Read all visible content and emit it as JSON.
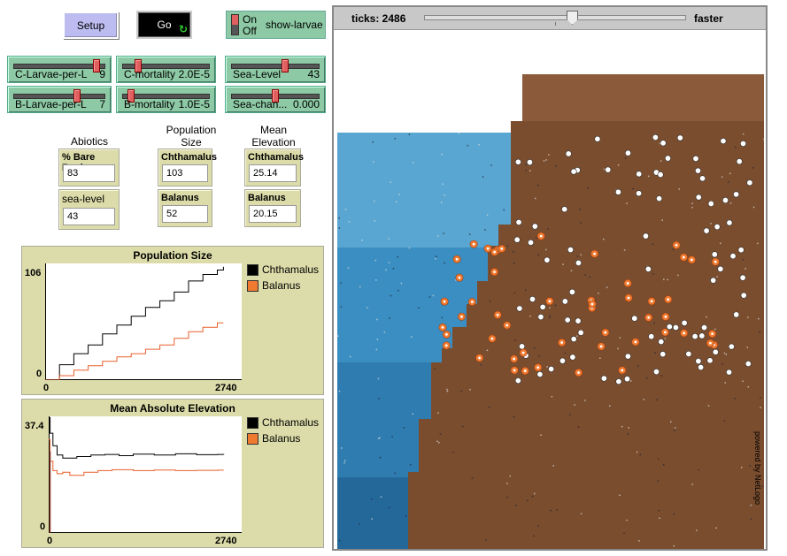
{
  "buttons": {
    "setup": "Setup",
    "go": "Go"
  },
  "switch": {
    "on": "On",
    "off": "Off",
    "label": "show-larvae"
  },
  "sliders": [
    {
      "label": "C-Larvae-per-L",
      "value": "9",
      "frac": 0.9
    },
    {
      "label": "C-mortality",
      "value": "2.0E-5",
      "frac": 0.1
    },
    {
      "label": "Sea-Level",
      "value": "43",
      "frac": 0.55
    },
    {
      "label": "B-Larvae-per-L",
      "value": "7",
      "frac": 0.7
    },
    {
      "label": "B-mortality",
      "value": "1.0E-5",
      "frac": 0.05
    },
    {
      "label": "Sea-chan...",
      "value": "0.000",
      "frac": 0.5
    }
  ],
  "headers": {
    "abiotics": "Abiotics",
    "population": "Population Size",
    "elevation": "Mean Elevation"
  },
  "monitors": {
    "bare_rock": {
      "label": "% Bare Rock",
      "value": "83"
    },
    "sea_level": {
      "label": "sea-level",
      "value": "43"
    },
    "pop_chth": {
      "label": "Chthamalus",
      "value": "103"
    },
    "pop_bal": {
      "label": "Balanus",
      "value": "52"
    },
    "elev_chth": {
      "label": "Chthamalus",
      "value": "25.14"
    },
    "elev_bal": {
      "label": "Balanus",
      "value": "20.15"
    }
  },
  "view": {
    "ticks_label": "ticks: 2486",
    "speed_label": "faster",
    "speed_frac": 0.56,
    "powered": "powered by NetLogo"
  },
  "colors": {
    "chthamalus": "#000000",
    "balanus": "#f07a30",
    "rock": "#7a4d2e",
    "sand": "#8a5a3a",
    "sea": "#4f9cc8"
  },
  "chart_data": [
    {
      "type": "line",
      "title": "Population Size",
      "xlim": [
        0,
        2740
      ],
      "ylim": [
        0,
        106
      ],
      "xtick_labels": [
        "0",
        "2740"
      ],
      "ytick_labels": [
        "0",
        "106"
      ],
      "series": [
        {
          "name": "Chthamalus",
          "color": "#000000",
          "x": [
            0,
            200,
            400,
            600,
            800,
            1000,
            1200,
            1400,
            1600,
            1800,
            2000,
            2200,
            2400,
            2486
          ],
          "y": [
            0,
            14,
            24,
            32,
            42,
            50,
            58,
            66,
            72,
            80,
            90,
            96,
            100,
            103
          ]
        },
        {
          "name": "Balanus",
          "color": "#e8602c",
          "x": [
            0,
            200,
            400,
            600,
            800,
            1000,
            1200,
            1400,
            1600,
            1800,
            2000,
            2200,
            2400,
            2486
          ],
          "y": [
            0,
            4,
            9,
            13,
            17,
            21,
            24,
            28,
            32,
            38,
            44,
            48,
            52,
            52
          ]
        }
      ],
      "legend": "right"
    },
    {
      "type": "line",
      "title": "Mean Absolute Elevation",
      "xlim": [
        0,
        2740
      ],
      "ylim": [
        0,
        37.4
      ],
      "xtick_labels": [
        "0",
        "2740"
      ],
      "ytick_labels": [
        "0",
        "37.4"
      ],
      "series": [
        {
          "name": "Chthamalus",
          "color": "#000000",
          "x": [
            0,
            20,
            60,
            120,
            200,
            400,
            600,
            800,
            1000,
            1200,
            1500,
            1800,
            2100,
            2400,
            2486
          ],
          "y": [
            37,
            32,
            28,
            25,
            24,
            24.5,
            25,
            25.2,
            24.8,
            25.3,
            25,
            25.4,
            25.1,
            25.2,
            25.14
          ]
        },
        {
          "name": "Balanus",
          "color": "#e8602c",
          "x": [
            0,
            20,
            60,
            120,
            200,
            300,
            500,
            700,
            900,
            1200,
            1500,
            1800,
            2100,
            2400,
            2486
          ],
          "y": [
            30,
            23,
            20,
            19,
            19.5,
            18.5,
            19.5,
            20,
            20.3,
            20,
            20.2,
            20,
            20.1,
            20.15,
            20.15
          ]
        }
      ],
      "legend": "right"
    }
  ]
}
